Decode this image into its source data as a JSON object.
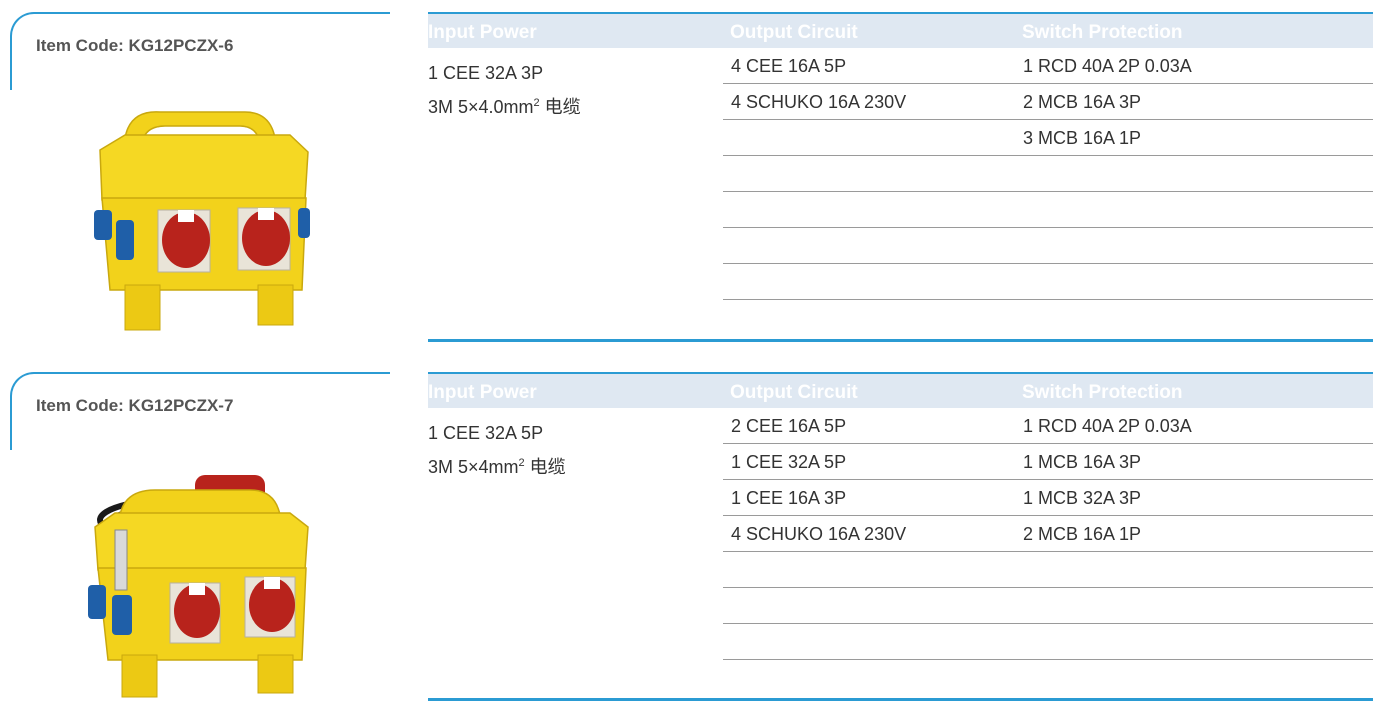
{
  "headers": {
    "input": "Input Power",
    "output": "Output Circuit",
    "switch": "Switch Protection"
  },
  "items": [
    {
      "code": "Item Code: KG12PCZX-6",
      "input_line1": "1 CEE 32A 3P",
      "input_line2_pre": "3M 5×4.0mm",
      "input_line2_sup": "2",
      "input_line2_post": " 电缆",
      "rows": [
        {
          "output": "4 CEE 16A 5P",
          "switch": "1 RCD 40A 2P 0.03A"
        },
        {
          "output": "4 SCHUKO 16A 230V",
          "switch": "2 MCB 16A 3P"
        },
        {
          "output": "",
          "switch": "3 MCB 16A 1P"
        },
        {
          "output": "",
          "switch": ""
        },
        {
          "output": "",
          "switch": ""
        },
        {
          "output": "",
          "switch": ""
        },
        {
          "output": "",
          "switch": ""
        },
        {
          "output": "",
          "switch": ""
        }
      ]
    },
    {
      "code": "Item Code: KG12PCZX-7",
      "input_line1": "1 CEE 32A 5P",
      "input_line2_pre": "3M 5×4mm",
      "input_line2_sup": "2",
      "input_line2_post": " 电缆",
      "rows": [
        {
          "output": "2 CEE 16A 5P",
          "switch": "1 RCD 40A 2P 0.03A"
        },
        {
          "output": "1 CEE 32A 5P",
          "switch": "1 MCB 16A 3P"
        },
        {
          "output": "1 CEE 16A 3P",
          "switch": "1 MCB 32A 3P"
        },
        {
          "output": "4 SCHUKO 16A 230V",
          "switch": "2 MCB 16A 1P"
        },
        {
          "output": "",
          "switch": ""
        },
        {
          "output": "",
          "switch": ""
        },
        {
          "output": "",
          "switch": ""
        }
      ]
    }
  ],
  "colors": {
    "accent": "#2b9bd3",
    "header_bg": "#dfe8f2",
    "box_yellow": "#f2d21b",
    "socket_red": "#b8231c",
    "socket_blue": "#1f5fa8"
  }
}
